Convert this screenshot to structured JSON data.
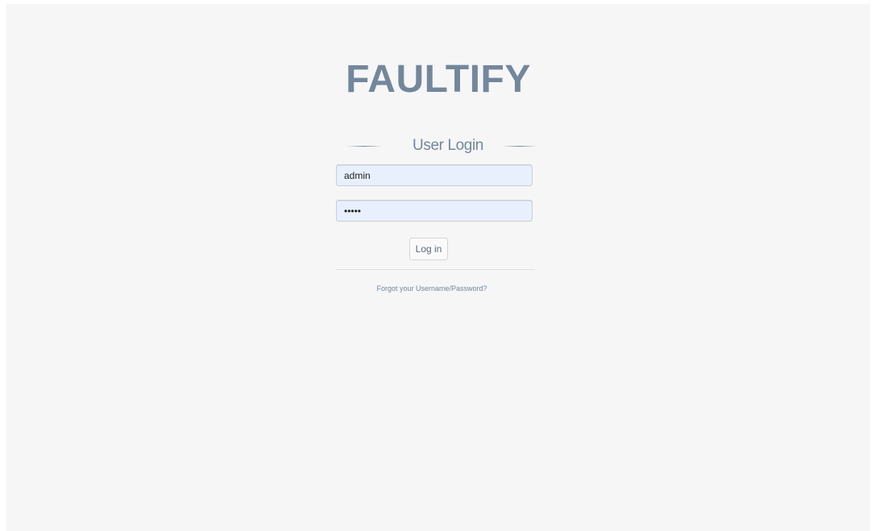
{
  "brand": {
    "title": "FAULTIFY"
  },
  "login": {
    "heading": "User Login",
    "username_value": "admin",
    "password_value": "•••••",
    "submit_label": "Log in",
    "forgot_link": "Forgot your Username/Password?"
  },
  "colors": {
    "brand_text": "#73879c",
    "page_background": "#f6f6f6",
    "input_background": "#e8f0fe"
  }
}
